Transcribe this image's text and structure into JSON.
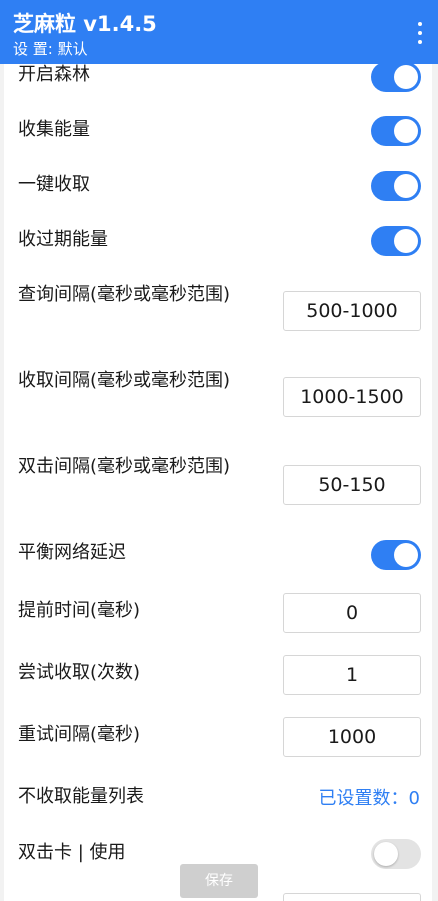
{
  "appbar": {
    "title": "芝麻粒 v1.4.5",
    "subtitle": "设 置: 默认",
    "menu_icon": "more-vertical-icon"
  },
  "settings": [
    {
      "label": "开启森林",
      "type": "switch",
      "on": true
    },
    {
      "label": "收集能量",
      "type": "switch",
      "on": true
    },
    {
      "label": "一键收取",
      "type": "switch",
      "on": true
    },
    {
      "label": "收过期能量",
      "type": "switch",
      "on": true
    },
    {
      "label": "查询间隔(毫秒或毫秒范围)",
      "type": "input",
      "value": "500-1000"
    },
    {
      "label": "收取间隔(毫秒或毫秒范围)",
      "type": "input",
      "value": "1000-1500"
    },
    {
      "label": "双击间隔(毫秒或毫秒范围)",
      "type": "input",
      "value": "50-150"
    },
    {
      "label": "平衡网络延迟",
      "type": "switch",
      "on": true
    },
    {
      "label": "提前时间(毫秒)",
      "type": "input",
      "value": "0"
    },
    {
      "label": "尝试收取(次数)",
      "type": "input",
      "value": "1"
    },
    {
      "label": "重试间隔(毫秒)",
      "type": "input",
      "value": "1000"
    },
    {
      "label": "不收取能量列表",
      "type": "count",
      "value": "已设置数：0"
    },
    {
      "label": "双击卡 | 使用",
      "type": "switch",
      "on": false
    }
  ],
  "save_button": {
    "label": "保存"
  },
  "colors": {
    "accent": "#2f7ff3",
    "switch_off": "#e3e3e3",
    "save_disabled": "#cfcfcf"
  }
}
